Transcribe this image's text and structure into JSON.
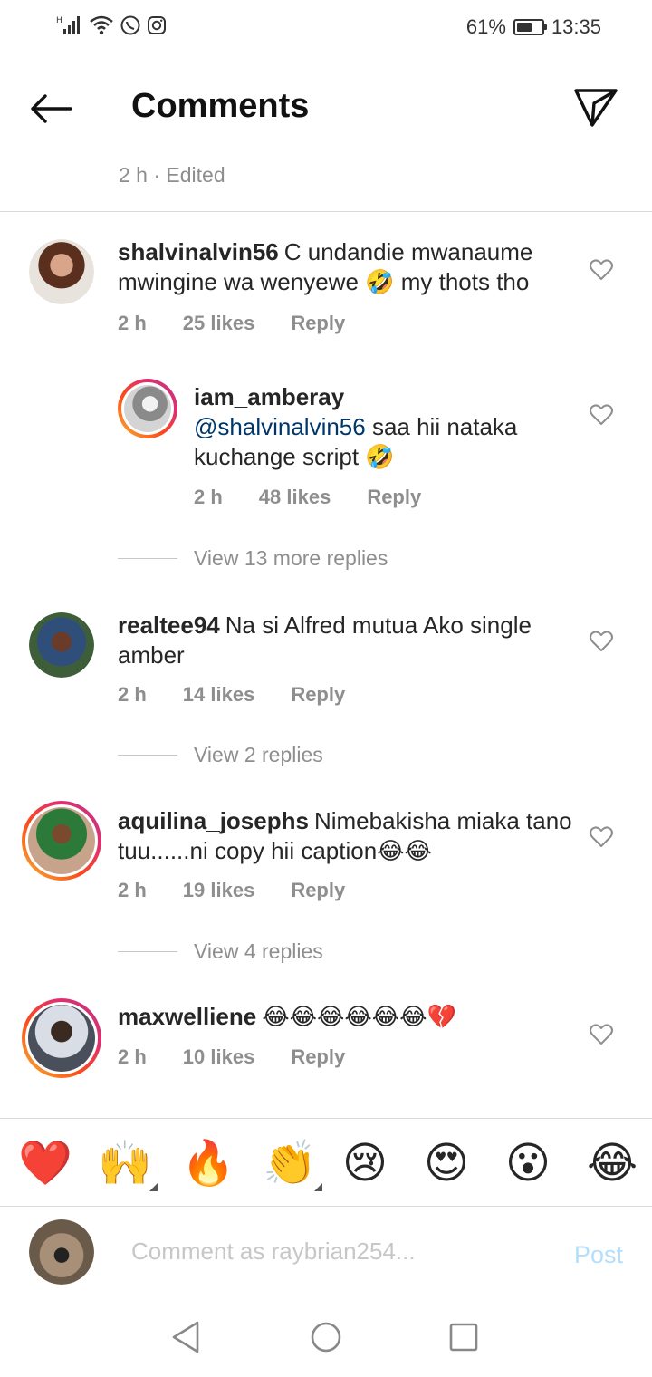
{
  "status_bar": {
    "battery_percent_text": "61%",
    "battery_level": 0.61,
    "time": "13:35",
    "icons": [
      "signal-icon",
      "wifi-icon",
      "whatsapp-icon",
      "instagram-icon",
      "battery-icon"
    ]
  },
  "header": {
    "title": "Comments",
    "back_icon": "arrow-left-icon",
    "send_icon": "paper-plane-icon"
  },
  "caption_meta": "2 h · Edited",
  "comments": [
    {
      "username": "shalvinalvin56",
      "text": "C undandie mwanaume mwingine wa wenyewe 🤣 my thots tho",
      "time": "2 h",
      "likes": "25 likes",
      "reply": "Reply"
    },
    {
      "username": "iam_amberay",
      "mention": "@shalvinalvin56",
      "text": " saa hii nataka kuchange script 🤣",
      "time": "2 h",
      "likes": "48 likes",
      "reply": "Reply"
    },
    {
      "username": "realtee94",
      "text": "Na si Alfred mutua Ako single amber",
      "time": "2 h",
      "likes": "14 likes",
      "reply": "Reply"
    },
    {
      "username": "aquilina_josephs",
      "text": "Nimebakisha miaka tano tuu......ni copy hii caption😂😂",
      "time": "2 h",
      "likes": "19 likes",
      "reply": "Reply"
    },
    {
      "username": "maxwelliene",
      "text": "😂😂😂😂😂😂💔",
      "time": "2 h",
      "likes": "10 likes",
      "reply": "Reply"
    }
  ],
  "view_replies": [
    "View 13 more replies",
    "View 2 replies",
    "View 4 replies"
  ],
  "emoji_bar": [
    "❤️",
    "🙌",
    "🔥",
    "👏",
    "😢",
    "😍",
    "😮",
    "😂"
  ],
  "composer": {
    "placeholder": "Comment as raybrian254...",
    "post_label": "Post"
  },
  "colors": {
    "text": "#262626",
    "meta": "#8e8e8e",
    "mention": "#00376b",
    "post_disabled": "#b2dffc",
    "divider": "#dbdbdb"
  }
}
